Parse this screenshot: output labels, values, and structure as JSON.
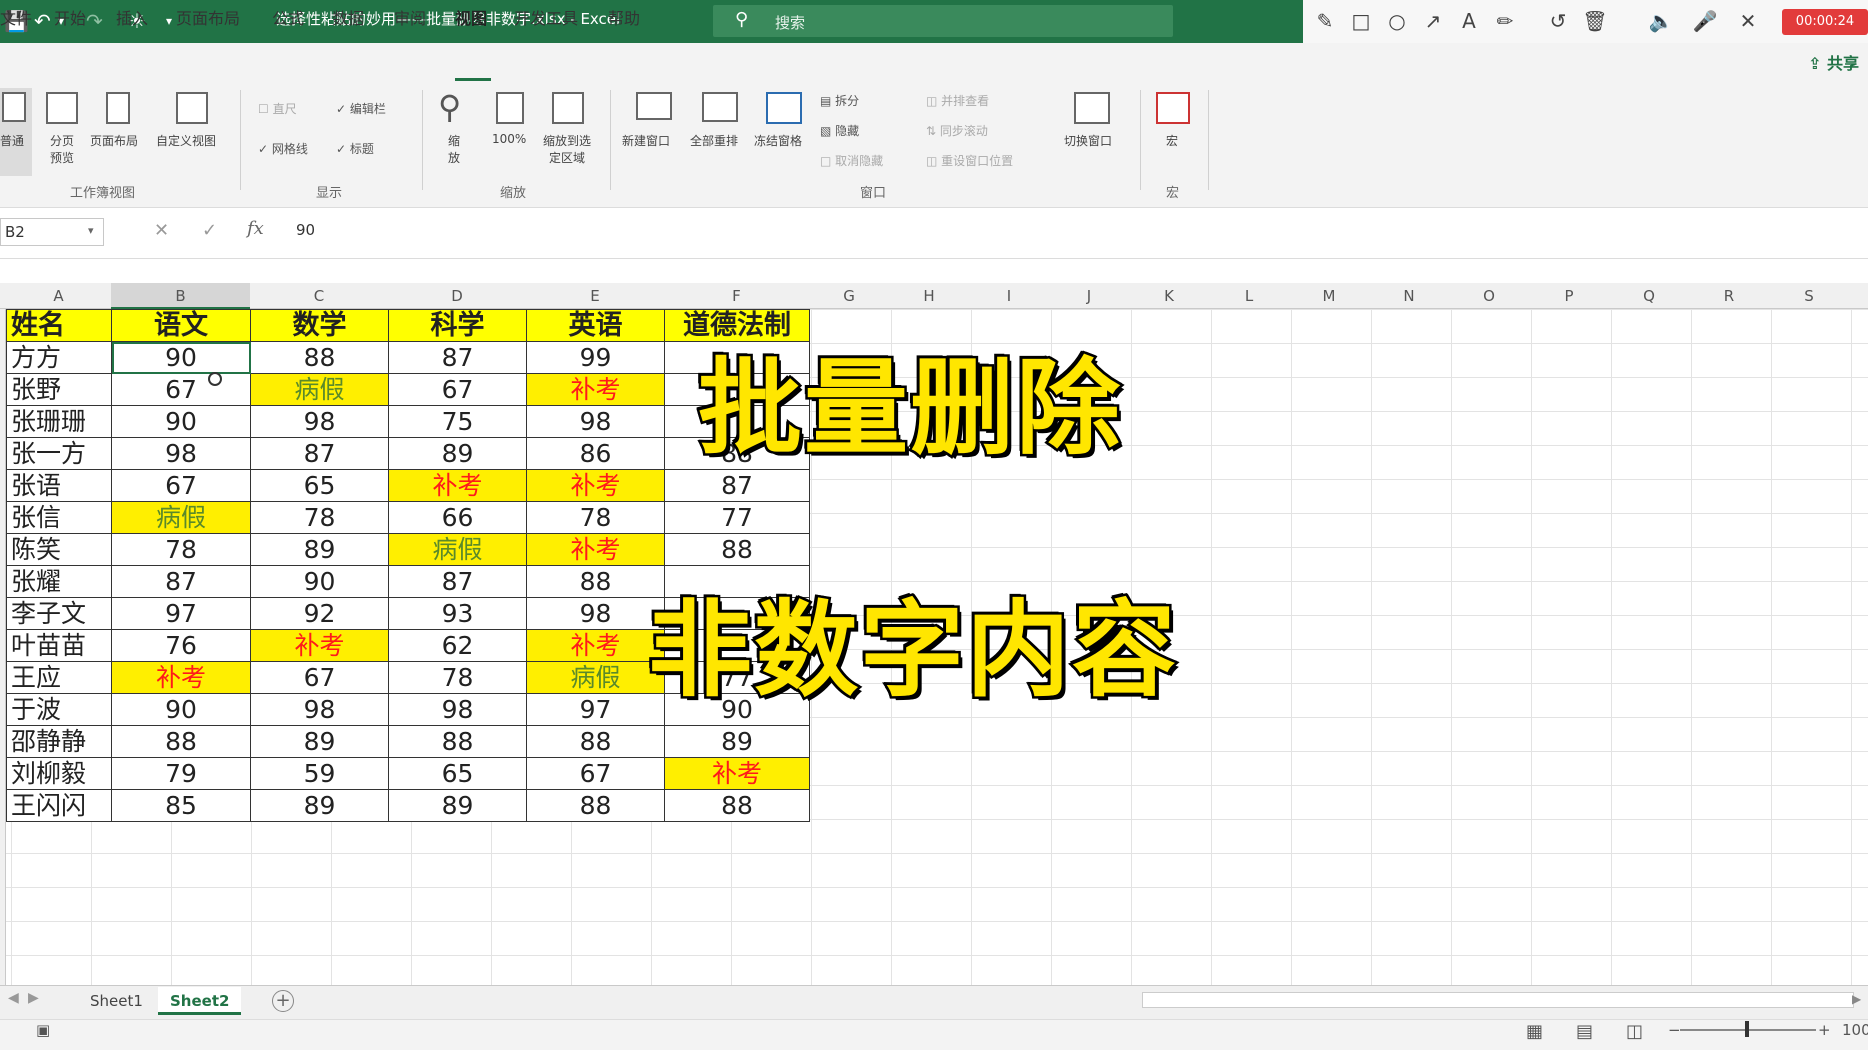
{
  "titlebar": {
    "document_title": "选择性粘贴的妙用——批量删除非数字.xlsx - Excel",
    "search_placeholder": "搜索",
    "recording_timer": "00:00:24"
  },
  "menu": {
    "tabs": [
      "文件",
      "开始",
      "插入",
      "页面布局",
      "公式",
      "数据",
      "审阅",
      "视图",
      "开发工具",
      "帮助"
    ],
    "active_tab": "视图",
    "share_label": "共享"
  },
  "ribbon": {
    "workbook_views": {
      "group_label": "工作簿视图",
      "buttons": [
        "普通",
        "分页预览",
        "页面布局",
        "自定义视图"
      ]
    },
    "show": {
      "group_label": "显示",
      "ruler": "直尺",
      "formula_bar": "编辑栏",
      "gridlines": "网格线",
      "headings": "标题"
    },
    "zoom": {
      "group_label": "缩放",
      "buttons": [
        "缩放",
        "100%",
        "缩放到选定区域"
      ]
    },
    "window": {
      "group_label": "窗口",
      "buttons": [
        "新建窗口",
        "全部重排",
        "冻结窗格"
      ],
      "small": [
        "拆分",
        "隐藏",
        "取消隐藏"
      ],
      "side": [
        "并排查看",
        "同步滚动",
        "重设窗口位置"
      ],
      "switch": "切换窗口"
    },
    "macros": {
      "group_label": "宏",
      "button": "宏"
    }
  },
  "formula_bar": {
    "name_box": "B2",
    "value": "90"
  },
  "columns": [
    "A",
    "B",
    "C",
    "D",
    "E",
    "F",
    "G",
    "H",
    "I",
    "J",
    "K",
    "L",
    "M",
    "N",
    "O",
    "P",
    "Q",
    "R",
    "S"
  ],
  "table": {
    "headers": [
      "姓名",
      "语文",
      "数学",
      "科学",
      "英语",
      "道德法制"
    ],
    "rows": [
      [
        "方方",
        "90",
        "88",
        "87",
        "99",
        ""
      ],
      [
        "张野",
        "67",
        "病假",
        "67",
        "补考",
        ""
      ],
      [
        "张珊珊",
        "90",
        "98",
        "75",
        "98",
        ""
      ],
      [
        "张一方",
        "98",
        "87",
        "89",
        "86",
        "88"
      ],
      [
        "张语",
        "67",
        "65",
        "补考",
        "补考",
        "87"
      ],
      [
        "张信",
        "病假",
        "78",
        "66",
        "78",
        "77"
      ],
      [
        "陈笑",
        "78",
        "89",
        "病假",
        "补考",
        "88"
      ],
      [
        "张耀",
        "87",
        "90",
        "87",
        "88",
        ""
      ],
      [
        "李子文",
        "97",
        "92",
        "93",
        "98",
        ""
      ],
      [
        "叶苗苗",
        "76",
        "补考",
        "62",
        "补考",
        ""
      ],
      [
        "王应",
        "补考",
        "67",
        "78",
        "病假",
        "77"
      ],
      [
        "于波",
        "90",
        "98",
        "98",
        "97",
        "90"
      ],
      [
        "邵静静",
        "88",
        "89",
        "88",
        "88",
        "89"
      ],
      [
        "刘柳毅",
        "79",
        "59",
        "65",
        "67",
        "补考"
      ],
      [
        "王闪闪",
        "85",
        "89",
        "89",
        "88",
        "88"
      ]
    ]
  },
  "overlay": {
    "line1": "批量删除",
    "line2": "非数字内容"
  },
  "sheets": [
    "Sheet1",
    "Sheet2"
  ],
  "active_sheet": "Sheet2",
  "status": {
    "zoom": "100"
  },
  "colors": {
    "excel_green": "#217346",
    "highlight_yellow": "#ffff00",
    "text_red": "#ff1a1a",
    "overlay_yellow": "#ffe600"
  }
}
